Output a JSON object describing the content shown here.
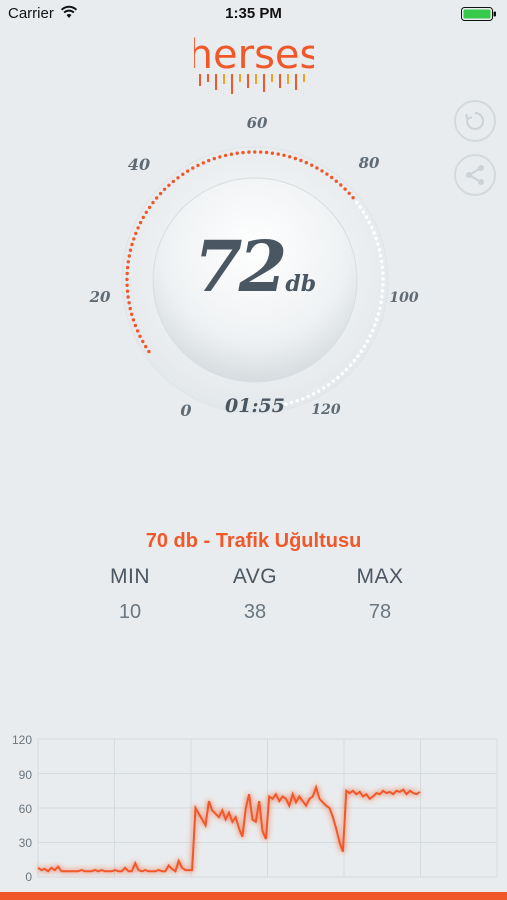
{
  "status_bar": {
    "carrier": "Carrier",
    "time": "1:35 PM"
  },
  "logo": {
    "text": "herses"
  },
  "gauge": {
    "ticks": [
      "0",
      "20",
      "40",
      "60",
      "80",
      "100",
      "120"
    ],
    "value": "72",
    "unit": "db",
    "timer": "01:55",
    "fill_fraction": 0.6,
    "accent_color": "#f0582a"
  },
  "level_description": "70 db - Trafik Uğultusu",
  "stats": {
    "min_label": "MIN",
    "min_value": "10",
    "avg_label": "AVG",
    "avg_value": "38",
    "max_label": "MAX",
    "max_value": "78"
  },
  "chart_data": {
    "type": "line",
    "yticks": [
      "120",
      "90",
      "60",
      "30",
      "0"
    ],
    "ylim": [
      0,
      120
    ],
    "grid": true,
    "series": [
      {
        "values": [
          8,
          6,
          7,
          5,
          8,
          6,
          9,
          5,
          5,
          5,
          5,
          5,
          5,
          6,
          5,
          5,
          5,
          6,
          5,
          6,
          5,
          5,
          5,
          6,
          5,
          5,
          8,
          5,
          5,
          12,
          6,
          5,
          6,
          5,
          5,
          5,
          6,
          5,
          5,
          10,
          7,
          5,
          14,
          8,
          6,
          6,
          6,
          60,
          55,
          50,
          45,
          66,
          58,
          55,
          52,
          58,
          50,
          56,
          48,
          52,
          42,
          35,
          60,
          72,
          50,
          48,
          66,
          40,
          33,
          70,
          68,
          72,
          66,
          70,
          68,
          62,
          72,
          65,
          70,
          66,
          62,
          68,
          70,
          78,
          68,
          65,
          62,
          60,
          52,
          42,
          30,
          22,
          75,
          73,
          75,
          72,
          74,
          70,
          72,
          68,
          70,
          73,
          72,
          75,
          73,
          74,
          72,
          75,
          74,
          76,
          72,
          75,
          73,
          72,
          74
        ]
      }
    ],
    "color": "#f0582a"
  },
  "icons": {
    "refresh": "refresh-icon",
    "share": "share-icon",
    "wifi": "wifi-icon",
    "battery": "battery-icon"
  }
}
